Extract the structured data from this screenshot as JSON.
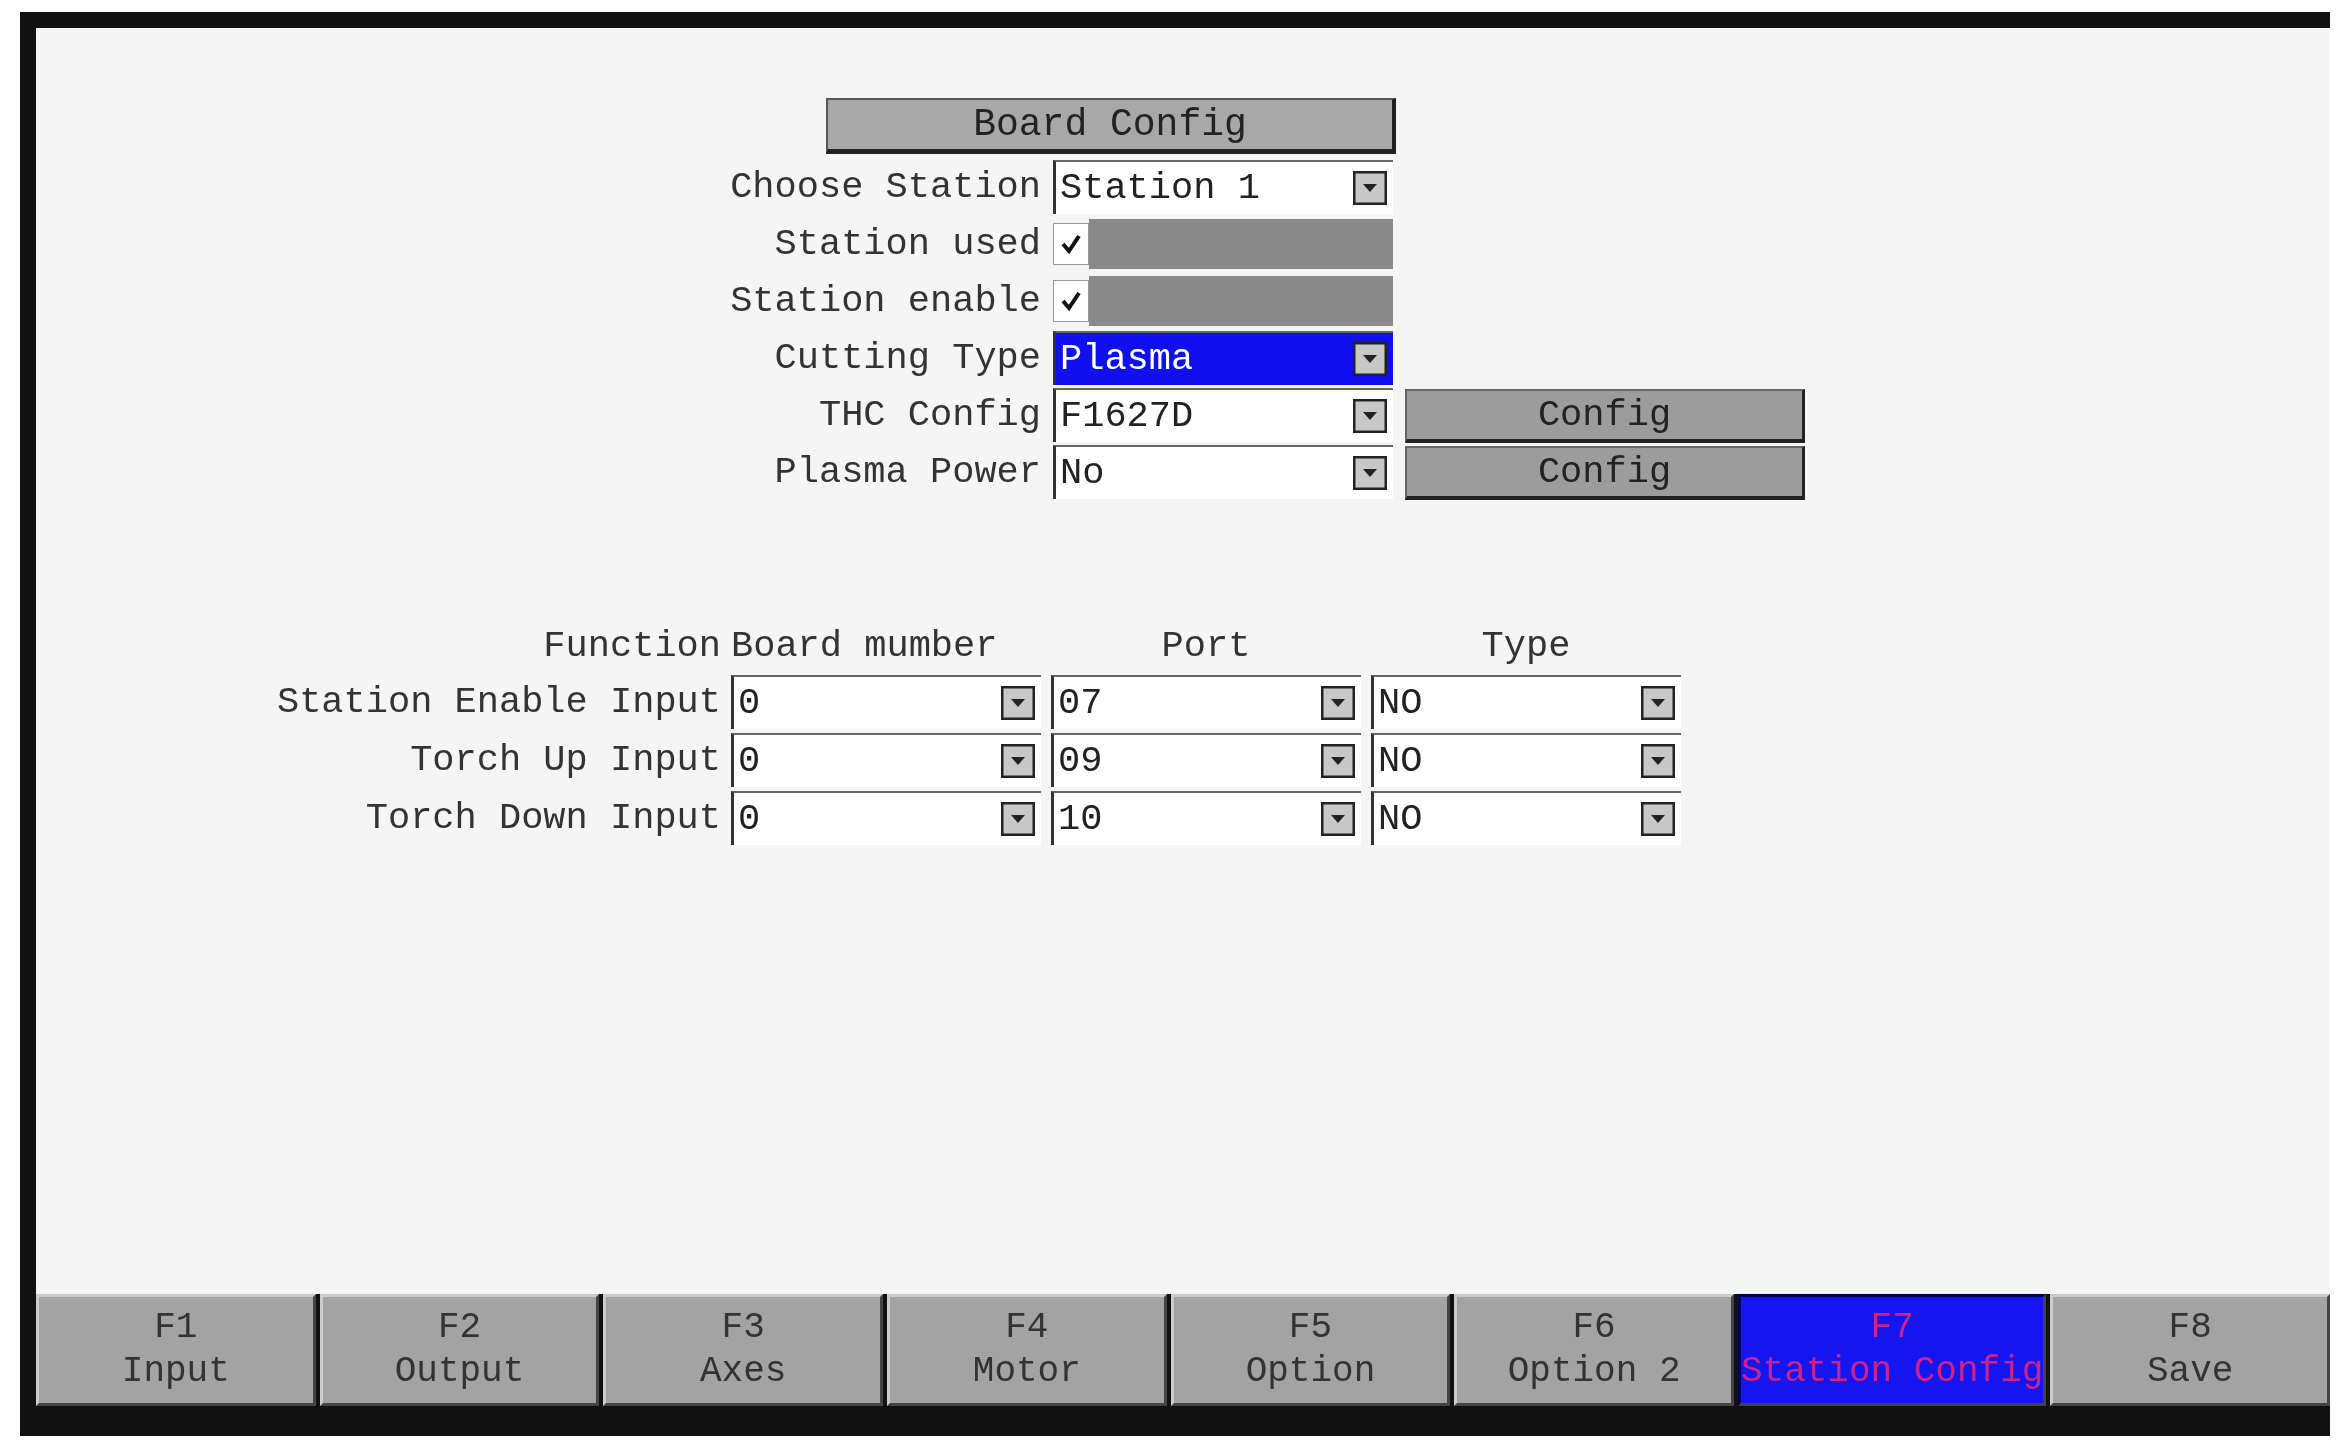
{
  "title_button": "Board Config",
  "settings": [
    {
      "label": "Choose Station",
      "kind": "dropdown",
      "value": "Station 1",
      "highlighted": false
    },
    {
      "label": "Station used",
      "kind": "checkbox",
      "checked": true
    },
    {
      "label": "Station enable",
      "kind": "checkbox",
      "checked": true
    },
    {
      "label": "Cutting Type",
      "kind": "dropdown",
      "value": "Plasma",
      "highlighted": true
    },
    {
      "label": "THC Config",
      "kind": "dropdown",
      "value": "F1627D",
      "highlighted": false,
      "button": "Config"
    },
    {
      "label": "Plasma Power",
      "kind": "dropdown",
      "value": "No",
      "highlighted": false,
      "button": "Config"
    }
  ],
  "io_table": {
    "columns": [
      "Function",
      "Board mumber",
      "Port",
      "Type"
    ],
    "rows": [
      {
        "function": "Station Enable Input",
        "board": "0",
        "port": "07",
        "type": "NO"
      },
      {
        "function": "Torch Up Input",
        "board": "0",
        "port": "09",
        "type": "NO"
      },
      {
        "function": "Torch Down Input",
        "board": "0",
        "port": "10",
        "type": "NO"
      }
    ]
  },
  "function_keys": [
    {
      "key": "F1",
      "label": "Input",
      "selected": false
    },
    {
      "key": "F2",
      "label": "Output",
      "selected": false
    },
    {
      "key": "F3",
      "label": "Axes",
      "selected": false
    },
    {
      "key": "F4",
      "label": "Motor",
      "selected": false
    },
    {
      "key": "F5",
      "label": "Option",
      "selected": false
    },
    {
      "key": "F6",
      "label": "Option 2",
      "selected": false
    },
    {
      "key": "F7",
      "label": "Station Config",
      "selected": true
    },
    {
      "key": "F8",
      "label": "Save",
      "selected": false
    }
  ]
}
